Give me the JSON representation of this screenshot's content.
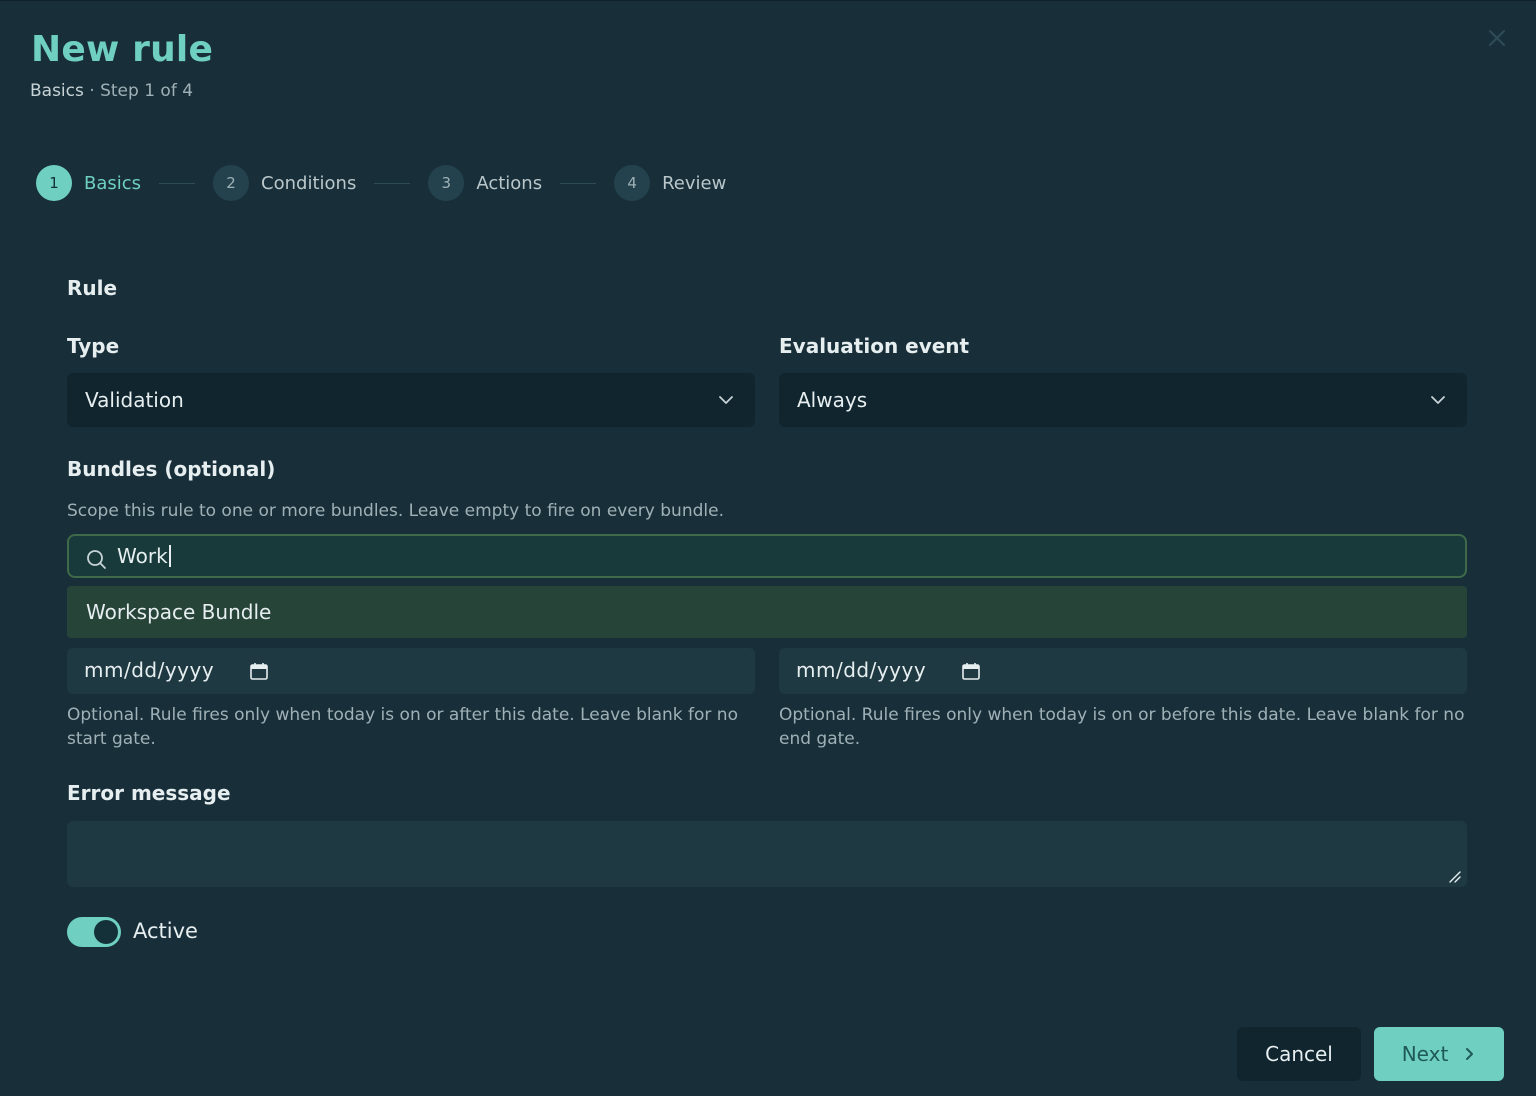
{
  "header": {
    "title": "New rule",
    "crumb": "Basics",
    "separator": " · ",
    "step_info": "Step 1 of 4"
  },
  "stepper": {
    "steps": [
      {
        "num": "1",
        "label": "Basics",
        "active": true
      },
      {
        "num": "2",
        "label": "Conditions",
        "active": false
      },
      {
        "num": "3",
        "label": "Actions",
        "active": false
      },
      {
        "num": "4",
        "label": "Review",
        "active": false
      }
    ]
  },
  "form": {
    "section_title": "Rule",
    "type": {
      "label": "Type",
      "value": "Validation"
    },
    "evaluation_event": {
      "label": "Evaluation event",
      "value": "Always"
    },
    "bundles": {
      "label": "Bundles (optional)",
      "hint": "Scope this rule to one or more bundles. Leave empty to fire on every bundle.",
      "search_value": "Work",
      "options": [
        "Workspace Bundle"
      ]
    },
    "start_date": {
      "value": "mm/dd/yyyy",
      "hint": "Optional. Rule fires only when today is on or after this date. Leave blank for no start gate."
    },
    "end_date": {
      "value": "mm/dd/yyyy",
      "hint": "Optional. Rule fires only when today is on or before this date. Leave blank for no end gate."
    },
    "error_message": {
      "label": "Error message",
      "value": ""
    },
    "active": {
      "label": "Active",
      "on": true
    }
  },
  "footer": {
    "cancel_label": "Cancel",
    "next_label": "Next"
  },
  "colors": {
    "accent": "#6fd0c1",
    "background": "#182f3a",
    "input_bg": "#10252e",
    "highlight": "#274439"
  }
}
